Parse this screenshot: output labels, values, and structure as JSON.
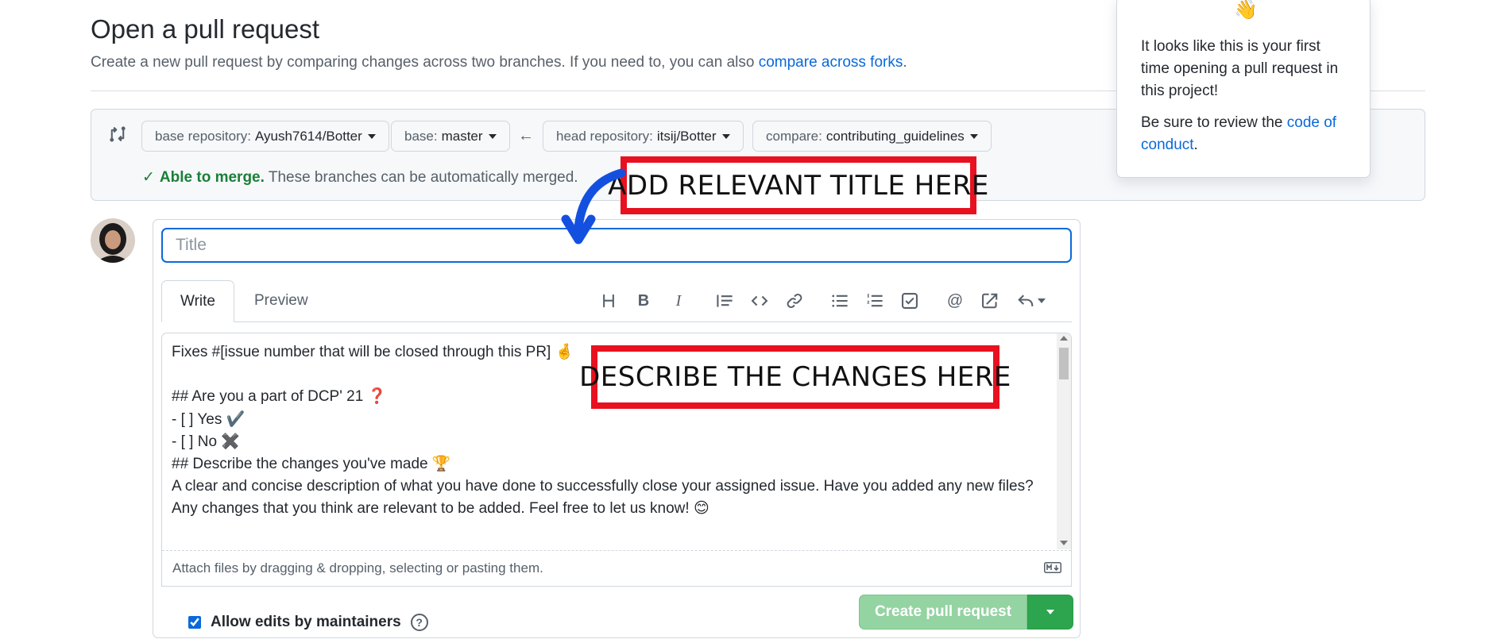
{
  "header": {
    "title": "Open a pull request",
    "subtitle_prefix": "Create a new pull request by comparing changes across two branches. If you need to, you can also ",
    "subtitle_link": "compare across forks",
    "subtitle_suffix": "."
  },
  "range": {
    "base_repo_label": "base repository:",
    "base_repo_value": "Ayush7614/Botter",
    "base_label": "base:",
    "base_value": "master",
    "head_repo_label": "head repository:",
    "head_repo_value": "itsij/Botter",
    "compare_label": "compare:",
    "compare_value": "contributing_guidelines",
    "merge_ok": "Able to merge.",
    "merge_text": "These branches can be automatically merged."
  },
  "popover": {
    "line1": "It looks like this is your first time opening a pull request in this project!",
    "line2_prefix": "Be sure to review the ",
    "line2_link": "code of conduct",
    "line2_suffix": "."
  },
  "composer": {
    "title_placeholder": "Title",
    "tab_write": "Write",
    "tab_preview": "Preview",
    "toolbar": [
      "heading-icon",
      "bold-icon",
      "italic-icon",
      "quote-icon",
      "code-icon",
      "link-icon",
      "unordered-list-icon",
      "ordered-list-icon",
      "task-list-icon",
      "mention-icon",
      "reference-icon",
      "reply-icon"
    ],
    "body_lines": [
      "Fixes #[issue number that will be closed through this PR] 🤞",
      "",
      "## Are you a part of DCP' 21 ❓",
      "- [ ] Yes ✔️",
      "- [ ] No ✖️",
      "## Describe the changes you've made 🏆",
      "A clear and concise description of what you have done to successfully close your assigned issue. Have you added any new files?",
      "Any changes that you think are relevant to be added. Feel free to let us know! 😊"
    ],
    "attach_text": "Attach files by dragging & dropping, selecting or pasting them.",
    "allow_edits_label": "Allow edits by maintainers",
    "create_button": "Create pull request"
  },
  "annotations": {
    "title_note": "ADD RELEVANT TITLE HERE",
    "desc_note": "DESCRIBE THE CHANGES HERE"
  },
  "colors": {
    "accent": "#0969da",
    "success": "#1a7f37",
    "create_disabled": "#94d3a2",
    "create_caret": "#2da44e",
    "annotation_red": "#e8111f",
    "annotation_arrow": "#1450e0"
  }
}
